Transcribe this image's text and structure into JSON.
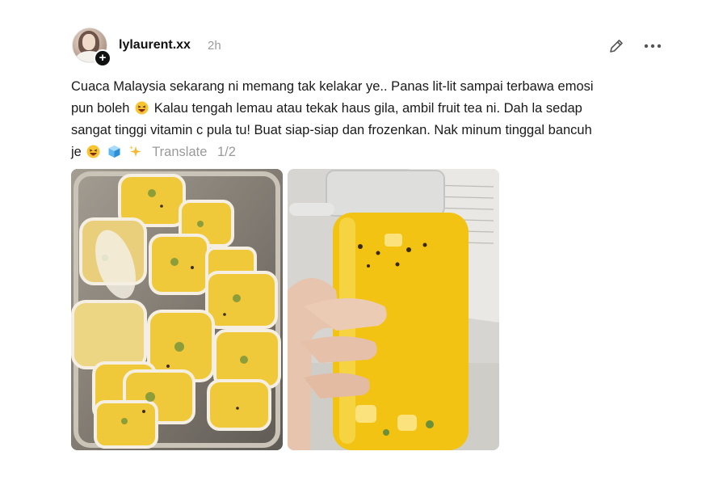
{
  "post": {
    "username": "lylaurent.xx",
    "timestamp": "2h",
    "caption_lines": [
      "Cuaca Malaysia sekarang ni memang tak kelakar ye.. Panas lit-lit sampai terbawa emosi",
      "pun boleh",
      "Kalau tengah lemau atau tekak haus gila, ambil fruit tea ni. Dah la sedap",
      "sangat tinggi vitamin c pula tu! Buat siap-siap dan frozenkan. Nak minum tinggal bancuh",
      "je"
    ],
    "translate_label": "Translate",
    "media_counter": "1/2"
  },
  "icons": {
    "avatar": "profile-photo",
    "follow": "plus-icon",
    "edit": "pencil-icon",
    "more": "ellipsis-icon",
    "emoji_1": "laughing-face-emoji",
    "emoji_2": "laughing-face-emoji",
    "emoji_3": "ice-cube-emoji",
    "emoji_4": "sparkles-emoji"
  },
  "colors": {
    "text": "#1a1a1a",
    "muted": "#9a9a9a",
    "juice_yellow": "#f2c313"
  }
}
